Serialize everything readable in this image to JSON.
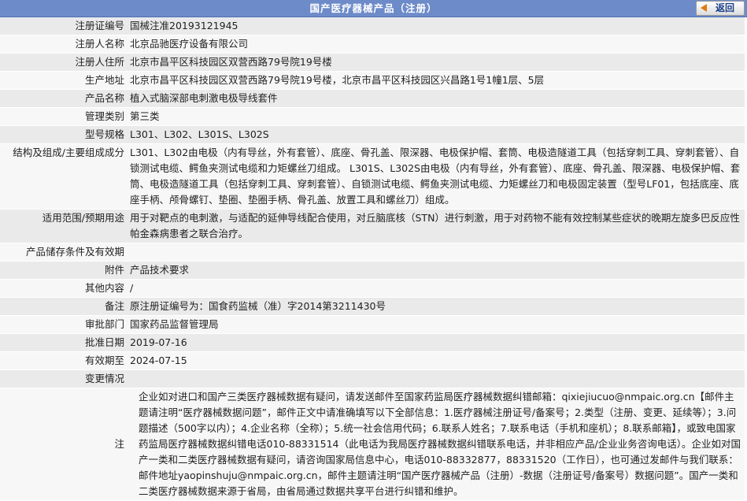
{
  "page_title": "国产医疗器械产品（注册）",
  "back_label": "返回",
  "rows": [
    {
      "label": "注册证编号",
      "value": "国械注准20193121945"
    },
    {
      "label": "注册人名称",
      "value": "北京品驰医疗设备有限公司"
    },
    {
      "label": "注册人住所",
      "value": "北京市昌平区科技园区双营西路79号院19号楼"
    },
    {
      "label": "生产地址",
      "value": "北京市昌平区科技园区双营西路79号院19号楼，北京市昌平区科技园区兴昌路1号1幢1层、5层"
    },
    {
      "label": "产品名称",
      "value": "植入式脑深部电刺激电极导线套件"
    },
    {
      "label": "管理类别",
      "value": "第三类"
    },
    {
      "label": "型号规格",
      "value": "L301、L302、L301S、L302S"
    },
    {
      "label": "结构及组成/主要组成成分",
      "value": "L301、L302由电极（内有导丝，外有套管）、底座、骨孔盖、限深器、电极保护帽、套筒、电极造隧道工具（包括穿刺工具、穿刺套管）、自锁测试电缆、鳄鱼夹测试电缆和力矩螺丝刀组成。 L301S、L302S由电极（内有导丝，外有套管）、底座、骨孔盖、限深器、电极保护帽、套筒、电极造隧道工具（包括穿刺工具、穿刺套管）、自锁测试电缆、鳄鱼夹测试电缆、力矩螺丝刀和电极固定装置（型号LF01，包括底座、底座手柄、颅骨螺钉、垫圈、垫圈手柄、骨孔盖、放置工具和螺丝刀）组成。"
    },
    {
      "label": "适用范围/预期用途",
      "value": "用于对靶点的电刺激，与适配的延伸导线配合使用，对丘脑底核（STN）进行刺激，用于对药物不能有效控制某些症状的晚期左旋多巴反应性帕金森病患者之联合治疗。"
    },
    {
      "label": "产品储存条件及有效期",
      "value": ""
    },
    {
      "label": "附件",
      "value": "产品技术要求"
    },
    {
      "label": "其他内容",
      "value": "/"
    },
    {
      "label": "备注",
      "value": "原注册证编号为：国食药监械（准）字2014第3211430号"
    },
    {
      "label": "审批部门",
      "value": "国家药品监督管理局"
    },
    {
      "label": "批准日期",
      "value": "2019-07-16"
    },
    {
      "label": "有效期至",
      "value": "2024-07-15"
    },
    {
      "label": "变更情况",
      "value": ""
    }
  ],
  "note": {
    "label": "注",
    "text": "企业如对进口和国产三类医疗器械数据有疑问，请发送邮件至国家药监局医疗器械数据纠错邮箱：qixiejiucuo@nmpaic.org.cn【邮件主题请注明“医疗器械数据问题”，邮件正文中请准确填写以下全部信息：1.医疗器械注册证号/备案号；2.类型（注册、变更、延续等）；3.问题描述（500字以内）；4.企业名称（全称）；5.统一社会信用代码；6.联系人姓名；7.联系电话（手机和座机）；8.联系邮箱】，或致电国家药监局医疗器械数据纠错电话010-88331514（此电话为我局医疗器械数据纠错联系电话，并非相应产品/企业业务咨询电话）。企业如对国产一类和二类医疗器械数据有疑问，请咨询国家局信息中心，电话010-88332877，88331520（工作日），也可通过发邮件与我们联系：邮件地址yaopinshuju@nmpaic.org.cn，邮件主题请注明“国产医疗器械产品（注册）-数据（注册证号/备案号）数据问题”。国产一类和二类医疗器械数据来源于省局，由省局通过数据共享平台进行纠错和维护。"
  }
}
